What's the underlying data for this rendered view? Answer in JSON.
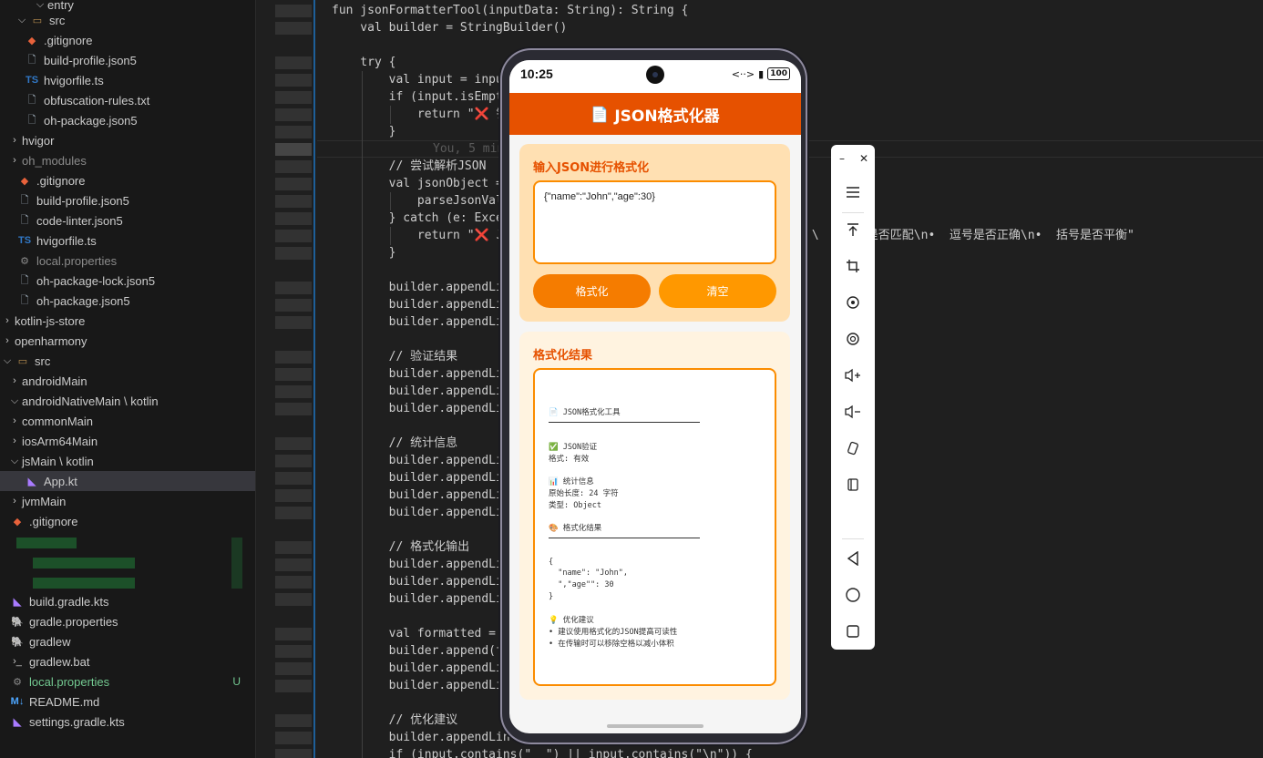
{
  "explorer": {
    "items": [
      {
        "label": "entry",
        "chevron": "⌵",
        "icon": "",
        "cls": ""
      },
      {
        "label": "src",
        "chevron": "⌵",
        "icon": "folder-src-icon",
        "cls": ""
      },
      {
        "label": ".gitignore",
        "chevron": "",
        "icon": "git-icon",
        "cls": ""
      },
      {
        "label": "build-profile.json5",
        "chevron": "",
        "icon": "file-icon",
        "cls": ""
      },
      {
        "label": "hvigorfile.ts",
        "chevron": "",
        "icon": "typescript-icon",
        "cls": ""
      },
      {
        "label": "obfuscation-rules.txt",
        "chevron": "",
        "icon": "file-icon",
        "cls": ""
      },
      {
        "label": "oh-package.json5",
        "chevron": "",
        "icon": "file-icon",
        "cls": ""
      },
      {
        "label": "hvigor",
        "chevron": "›",
        "icon": "",
        "cls": ""
      },
      {
        "label": "oh_modules",
        "chevron": "›",
        "icon": "",
        "cls": "muted"
      },
      {
        "label": ".gitignore",
        "chevron": "",
        "icon": "git-icon",
        "cls": ""
      },
      {
        "label": "build-profile.json5",
        "chevron": "",
        "icon": "file-icon",
        "cls": ""
      },
      {
        "label": "code-linter.json5",
        "chevron": "",
        "icon": "file-icon",
        "cls": ""
      },
      {
        "label": "hvigorfile.ts",
        "chevron": "",
        "icon": "typescript-icon",
        "cls": ""
      },
      {
        "label": "local.properties",
        "chevron": "",
        "icon": "gear-icon",
        "cls": "muted"
      },
      {
        "label": "oh-package-lock.json5",
        "chevron": "",
        "icon": "file-icon",
        "cls": ""
      },
      {
        "label": "oh-package.json5",
        "chevron": "",
        "icon": "file-icon",
        "cls": ""
      },
      {
        "label": "kotlin-js-store",
        "chevron": "›",
        "icon": "",
        "cls": ""
      },
      {
        "label": "openharmony",
        "chevron": "›",
        "icon": "",
        "cls": ""
      },
      {
        "label": "src",
        "chevron": "⌵",
        "icon": "folder-src-icon",
        "cls": ""
      },
      {
        "label": "androidMain",
        "chevron": "›",
        "icon": "",
        "cls": ""
      },
      {
        "label": "androidNativeMain \\ kotlin",
        "chevron": "⌵",
        "icon": "",
        "cls": ""
      },
      {
        "label": "commonMain",
        "chevron": "›",
        "icon": "",
        "cls": ""
      },
      {
        "label": "iosArm64Main",
        "chevron": "›",
        "icon": "",
        "cls": ""
      },
      {
        "label": "jsMain \\ kotlin",
        "chevron": "⌵",
        "icon": "",
        "cls": ""
      },
      {
        "label": "App.kt",
        "chevron": "",
        "icon": "kotlin-icon",
        "cls": ""
      },
      {
        "label": "jvmMain",
        "chevron": "›",
        "icon": "",
        "cls": ""
      },
      {
        "label": ".gitignore",
        "chevron": "",
        "icon": "git-icon",
        "cls": ""
      },
      {
        "label": "build.gradle.kts",
        "chevron": "",
        "icon": "kotlin-icon",
        "cls": ""
      },
      {
        "label": "gradle.properties",
        "chevron": "",
        "icon": "gradle-icon",
        "cls": ""
      },
      {
        "label": "gradlew",
        "chevron": "",
        "icon": "gradle-icon",
        "cls": ""
      },
      {
        "label": "gradlew.bat",
        "chevron": "",
        "icon": "terminal-icon",
        "cls": ""
      },
      {
        "label": "local.properties",
        "chevron": "",
        "icon": "gear-icon",
        "cls": "green"
      },
      {
        "label": "README.md",
        "chevron": "",
        "icon": "markdown-icon",
        "cls": ""
      },
      {
        "label": "settings.gradle.kts",
        "chevron": "",
        "icon": "kotlin-icon",
        "cls": ""
      }
    ],
    "local_properties_status": "U"
  },
  "code": {
    "lines": [
      "fun jsonFormatterTool(inputData: String): String {",
      "    val builder = StringBuilder()",
      "",
      "    try {",
      "        val input = inpu",
      "        if (input.isEmpt",
      "            return \"❌ 错",
      "        }",
      "",
      "        // 尝试解析JSON",
      "        val jsonObject =",
      "            parseJsonVal",
      "        } catch (e: Exce",
      "            return \"❌ J",
      "        }",
      "",
      "        builder.appendLi",
      "        builder.appendLi",
      "        builder.appendLi",
      "",
      "        // 验证结果",
      "        builder.appendLi",
      "        builder.appendLi",
      "        builder.appendLi",
      "",
      "        // 统计信息",
      "        builder.appendLi",
      "        builder.appendLi",
      "        builder.appendLi",
      "        builder.appendLi",
      "",
      "        // 格式化输出",
      "        builder.appendLi",
      "        builder.appendLi",
      "        builder.appendLi",
      "",
      "        val formatted =",
      "        builder.append(f",
      "        builder.appendLi",
      "        builder.appendLi",
      "",
      "        // 优化建议",
      "        builder.appendLin",
      "        if (input.contains(\"  \") || input.contains(\"\\n\")) {"
    ],
    "blame": "You, 5 min",
    "overflow_text": "查:\\     号是否匹配\\n•  逗号是否正确\\n•  括号是否平衡\""
  },
  "phone": {
    "time": "10:25",
    "status_icons": "<··>",
    "battery": "100",
    "app_title": "JSON格式化器",
    "input_card_title": "输入JSON进行格式化",
    "input_value": "{\"name\":\"John\",\"age\":30}",
    "format_button": "格式化",
    "clear_button": "清空",
    "result_card_title": "格式化结果",
    "result": {
      "header": "📄 JSON格式化工具",
      "validate_title": "✅ JSON验证",
      "validate_line": "格式: 有效",
      "stats_title": "📊 统计信息",
      "stats_length": "原始长度: 24 字符",
      "stats_type": "类型: Object",
      "formatted_title": "🎨 格式化结果",
      "json_open": "{",
      "json_name": "  \"name\": \"John\",",
      "json_age": "  \",\"age\"\": 30",
      "json_close": "}",
      "advice_title": "💡 优化建议",
      "advice_1": "• 建议使用格式化的JSON提高可读性",
      "advice_2": "• 在传输时可以移除空格以减小体积"
    }
  },
  "toolbar": {
    "minimize": "–",
    "close": "✕"
  },
  "colors": {
    "accent": "#e65100",
    "button_primary": "#f57c00",
    "button_secondary": "#ff9800",
    "input_card": "#ffe0b2",
    "result_card": "#fff3e0"
  }
}
